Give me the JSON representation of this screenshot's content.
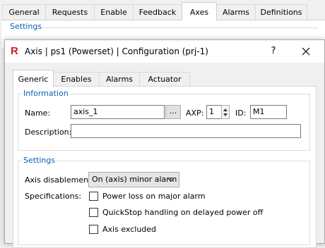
{
  "background": {
    "tabs": [
      {
        "label": "General"
      },
      {
        "label": "Requests"
      },
      {
        "label": "Enable"
      },
      {
        "label": "Feedback"
      },
      {
        "label": "Axes"
      },
      {
        "label": "Alarms"
      },
      {
        "label": "Definitions"
      }
    ],
    "settings_label": "Settings"
  },
  "dialog": {
    "app_icon_letter": "R",
    "title": "Axis | ps1 (Powerset) | Configuration (prj-1)",
    "help_label": "?",
    "tabs": [
      {
        "label": "Generic"
      },
      {
        "label": "Enables"
      },
      {
        "label": "Alarms"
      },
      {
        "label": "Actuator"
      }
    ],
    "information": {
      "group_label": "Information",
      "name_label": "Name:",
      "name_value": "axis_1",
      "browse_label": "...",
      "axp_label": "AXP:",
      "axp_value": "1",
      "id_label": "ID:",
      "id_value": "M1",
      "description_label": "Description:",
      "description_value": ""
    },
    "settings": {
      "group_label": "Settings",
      "axis_disablement_label": "Axis disablement:",
      "axis_disablement_value": "On (axis) minor alarm",
      "specifications_label": "Specifications:",
      "checkboxes": [
        {
          "label": "Power loss on major alarm",
          "checked": false
        },
        {
          "label": "QuickStop handling on delayed power off",
          "checked": false
        },
        {
          "label": "Axis excluded",
          "checked": false
        }
      ]
    }
  },
  "colors": {
    "group_label": "#0a5fb4",
    "app_icon": "#d21b1b"
  }
}
